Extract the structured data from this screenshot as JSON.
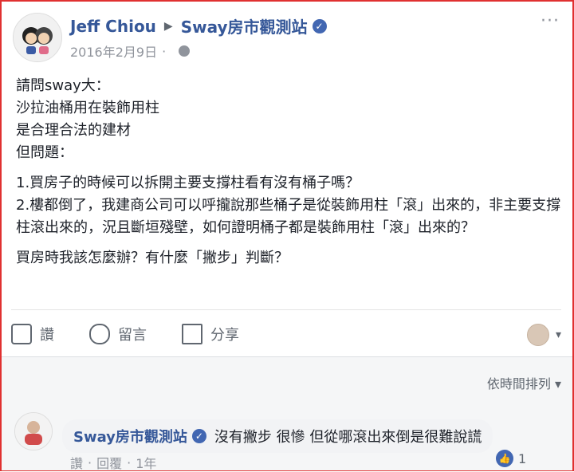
{
  "post": {
    "author": "Jeff Chiou",
    "target": "Sway房市觀測站",
    "date": "2016年2月9日",
    "meta_separator": "·",
    "more_label": "···",
    "body": [
      "請問sway大：",
      "沙拉油桶用在裝飾用柱",
      "是合理合法的建材",
      "但問題："
    ],
    "qa": [
      "1.買房子的時候可以拆開主要支撐柱看有沒有桶子嗎？",
      "2.樓都倒了，我建商公司可以呼攏說那些桶子是從裝飾用柱「滾」出來的，非主要支撐柱滾出來的，況且斷垣殘壁，如何證明桶子都是裝飾用柱「滾」出來的？"
    ],
    "closing": "買房時我該怎麼辦？有什麼「撇步」判斷？"
  },
  "actions": {
    "like": "讚",
    "comment": "留言",
    "share": "分享"
  },
  "comments": {
    "sort_label": "依時間排列 ▾",
    "items": [
      {
        "author": "Sway房市觀測站",
        "text": "沒有撇步 很慘 但從哪滾出來倒是很難說謊",
        "like_label": "讚",
        "reply_label": "回覆",
        "age": "1年",
        "dot": "·",
        "reactions": "1"
      }
    ]
  },
  "colors": {
    "link": "#365899",
    "text": "#1d2129",
    "muted": "#90949c",
    "accent": "#4267b2"
  }
}
